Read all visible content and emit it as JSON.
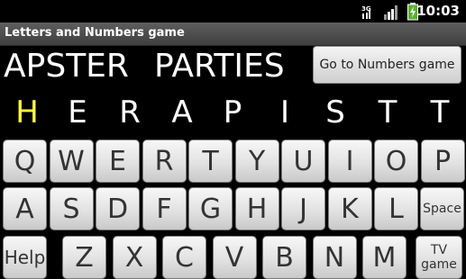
{
  "status_bar": {
    "time": "10:03",
    "network_label": "3G"
  },
  "app": {
    "title": "Letters and Numbers game"
  },
  "words": {
    "first": "APSTER",
    "second": "PARTIES"
  },
  "goto_button": {
    "label": "Go to Numbers game"
  },
  "target_letters": [
    "H",
    "E",
    "R",
    "A",
    "P",
    "I",
    "S",
    "T",
    "T"
  ],
  "active_letter_index": 0,
  "keyboard": {
    "row1": [
      "Q",
      "W",
      "E",
      "R",
      "T",
      "Y",
      "U",
      "I",
      "O",
      "P"
    ],
    "row2": [
      "A",
      "S",
      "D",
      "F",
      "G",
      "H",
      "J",
      "K",
      "L"
    ],
    "space_label": "Space",
    "help_label": "Help",
    "row3": [
      "Z",
      "X",
      "C",
      "V",
      "B",
      "N",
      "M"
    ],
    "tv_label_line1": "TV",
    "tv_label_line2": "game"
  },
  "colors": {
    "active_letter": "#ffff33",
    "background": "#000000"
  }
}
